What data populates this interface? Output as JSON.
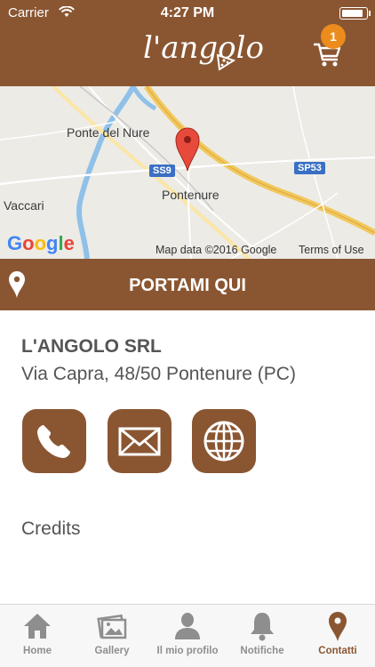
{
  "status_bar": {
    "carrier": "Carrier",
    "time": "4:27 PM",
    "battery_level": 0.9
  },
  "header": {
    "logo_text": "l'angolo",
    "cart_badge": "1",
    "cart_icon": "cart-icon"
  },
  "map": {
    "places": [
      "Ponte del Nure",
      "Vaccari",
      "Pontenure"
    ],
    "road_shields": [
      "SS9",
      "SP53"
    ],
    "google_logo": "Google",
    "attribution": "Map data ©2016 Google",
    "terms": "Terms of Use"
  },
  "directions": {
    "label": "PORTAMI QUI",
    "icon": "map-pin-icon"
  },
  "contact": {
    "company": "L'ANGOLO SRL",
    "address": "Via Capra, 48/50 Pontenure (PC)",
    "actions": [
      "phone-icon",
      "mail-icon",
      "globe-icon"
    ]
  },
  "credits_label": "Credits",
  "tabbar": {
    "items": [
      {
        "label": "Home",
        "icon": "home-icon",
        "active": false
      },
      {
        "label": "Gallery",
        "icon": "gallery-icon",
        "active": false
      },
      {
        "label": "Il mio profilo",
        "icon": "profile-icon",
        "active": false
      },
      {
        "label": "Notifiche",
        "icon": "bell-icon",
        "active": false
      },
      {
        "label": "Contatti",
        "icon": "map-pin-icon",
        "active": true
      }
    ]
  },
  "colors": {
    "brand": "#8a5632",
    "badge": "#ec8c1c",
    "tab_inactive": "#8e8e8e",
    "tab_active": "#8a5632"
  }
}
